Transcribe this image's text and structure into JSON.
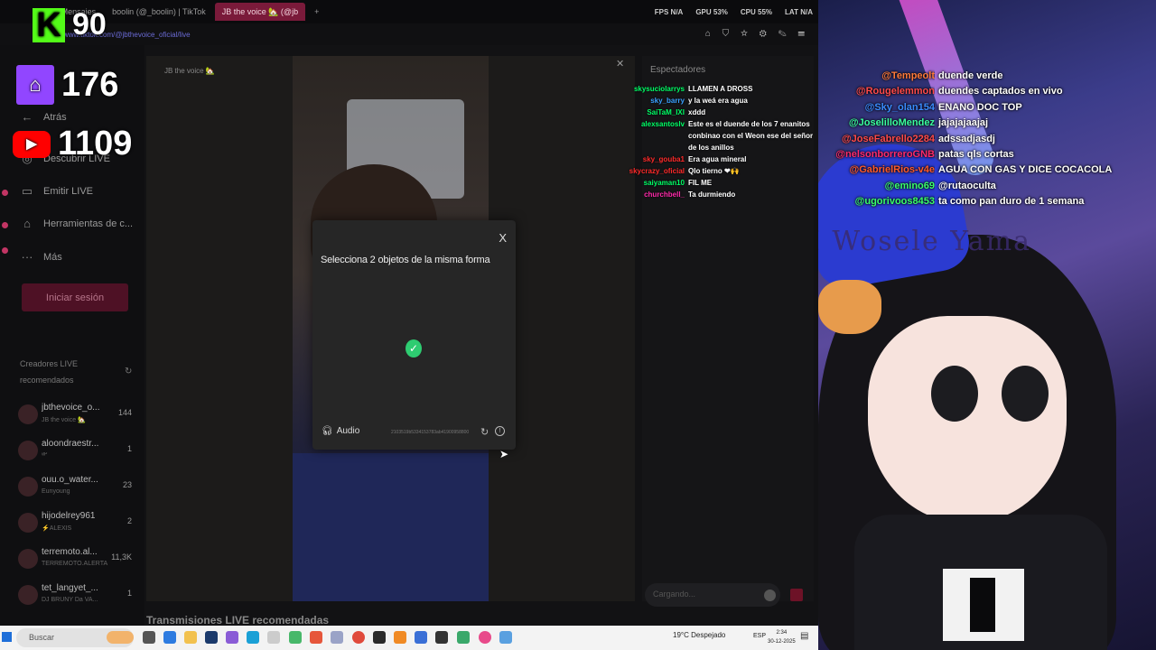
{
  "browser": {
    "tabs": [
      "ram • Mensajes",
      "boolin (@_boolin) | TikTok",
      "JB the voice 🏡 (@jb"
    ],
    "active_tab": 2,
    "metrics": {
      "fps": "FPS N/A",
      "gpu": "GPU 53%",
      "cpu": "CPU 55%",
      "lat": "LAT N/A"
    },
    "url": "www.tiktok.com/@jbthevoice_oficial/live",
    "tools_icons": "⌂ ⛉ ☆ ⚙ ✎ ☰"
  },
  "counters": {
    "kick": {
      "logo": "K",
      "count": "90",
      "color": "#53fc18"
    },
    "twitch": {
      "logo": "⬛",
      "count": "176",
      "color": "#9146ff"
    },
    "youtube": {
      "logo": "▶",
      "count": "1109",
      "color": "#ff0000"
    }
  },
  "leftnav": {
    "items": [
      {
        "icon": "←",
        "label": "Atrás"
      },
      {
        "icon": "◎",
        "label": "Descubrir LIVE"
      },
      {
        "icon": "▭",
        "label": "Emitir LIVE"
      },
      {
        "icon": "⌂",
        "label": "Herramientas de c..."
      },
      {
        "icon": "···",
        "label": "Más"
      }
    ],
    "login": "Iniciar sesión",
    "creators_header": "Creadores LIVE recomendados",
    "creators": [
      {
        "name": "jbthevoice_o...",
        "sub": "JB the voice 🏡",
        "count": "144"
      },
      {
        "name": "aloondraestr...",
        "sub": "ᵛᴵᴾ",
        "count": "1"
      },
      {
        "name": "ouu.o_water...",
        "sub": "Eunyoung",
        "count": "23"
      },
      {
        "name": "hijodelrey961",
        "sub": "⚡ALEXIS",
        "count": "2"
      },
      {
        "name": "terremoto.al...",
        "sub": "TERREMOTO.ALERTA",
        "count": "11,3K"
      },
      {
        "name": "tet_langyet_...",
        "sub": "DJ BRUNY Da VA...",
        "count": "1"
      }
    ]
  },
  "player": {
    "title": "JB the voice 🏡",
    "captcha": {
      "title": "Selecciona 2 objetos de la misma forma",
      "close": "X",
      "check": "✓",
      "audio_label": "Audio",
      "id_text": "2103519b5334153783ab41900958800",
      "reload": "↻",
      "info": "!"
    }
  },
  "viewers": {
    "title": "Espectadores",
    "input_placeholder": "Cargando..."
  },
  "recommended_label": "Transmisiones LIVE recomendadas",
  "chat_small": [
    {
      "user": "skysuciolarrys",
      "color": "#00ff66",
      "msg": "LLAMEN A DROSS"
    },
    {
      "user": "sky_barry",
      "color": "#3aa0ff",
      "msg": "y la weá era agua"
    },
    {
      "user": "SaiTaM_IXI",
      "color": "#00ff66",
      "msg": "xddd"
    },
    {
      "user": "alexsantoslv",
      "color": "#00ff66",
      "msg": "Este es el duende de los 7 enanitos conbinao con el Weon ese del señor de los anillos"
    },
    {
      "user": "sky_gouba1",
      "color": "#ff2a2a",
      "msg": "Era agua mineral"
    },
    {
      "user": "skycrazy_oficial",
      "color": "#ff2a2a",
      "msg": "Qlo tierno ❤🙌"
    },
    {
      "user": "saiyaman10",
      "color": "#00ff66",
      "msg": "FIL ME"
    },
    {
      "user": "churchbell_",
      "color": "#ff2aaa",
      "msg": "Ta durmiendo"
    }
  ],
  "chat_big": [
    {
      "user": "@Tempeolt",
      "color": "#ff7a3a",
      "msg": "duende verde"
    },
    {
      "user": "@Rougelemmon",
      "color": "#ff4a4a",
      "msg": "duendes captados en vivo"
    },
    {
      "user": "@Sky_olan154",
      "color": "#3a8cff",
      "msg": "ENANO DOC TOP"
    },
    {
      "user": "@JoselilloMendez",
      "color": "#3affa0",
      "msg": "jajajajaajaj"
    },
    {
      "user": "@JoseFabrello2284",
      "color": "#ff4a4a",
      "msg": "adssadjasdj"
    },
    {
      "user": "@nelsonborreroGNB",
      "color": "#ff2a6a",
      "msg": "patas qls cortas"
    },
    {
      "user": "@GabrielRios-v4e",
      "color": "#ff5a2a",
      "msg": "AGUA CON GAS Y DICE COCACOLA"
    },
    {
      "user": "@emino69",
      "color": "#3aff6a",
      "msg": "@rutaoculta"
    },
    {
      "user": "@ugorivoos8453",
      "color": "#3aff6a",
      "msg": "ta como pan duro de 1 semana"
    }
  ],
  "scene": {
    "hat_text": "I Wosele Yama"
  },
  "taskbar": {
    "search_placeholder": "Buscar",
    "weather": "19°C Despejado",
    "lang": "ESP",
    "time": "2:34",
    "date": "30-12-2025"
  }
}
